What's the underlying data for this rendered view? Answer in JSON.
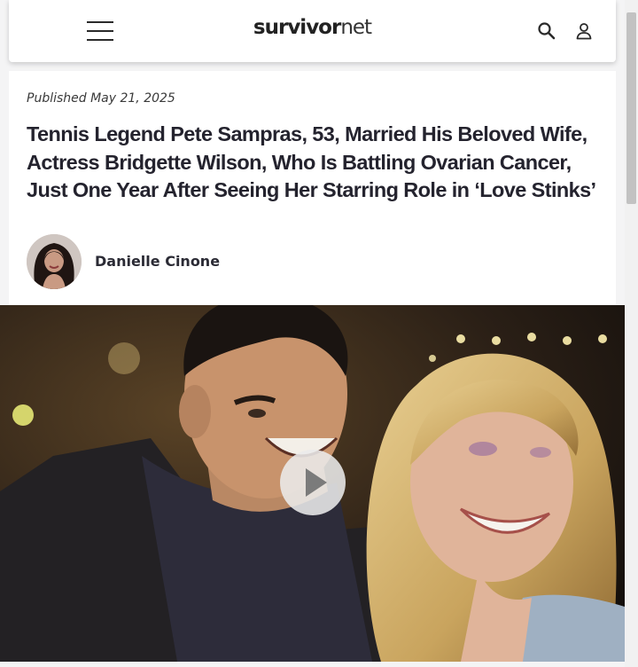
{
  "header": {
    "logo_part1": "survivor",
    "logo_part2": "net",
    "menu_icon": "hamburger-menu-icon",
    "search_icon": "search-icon",
    "account_icon": "user-icon"
  },
  "article": {
    "published": "Published May 21, 2025",
    "headline": "Tennis Legend Pete Sampras, 53, Married His Beloved Wife, Actress Bridgette Wilson, Who Is Battling Ovarian Cancer, Just One Year After Seeing Her Starring Role in ‘Love Stinks’",
    "author": "Danielle Cinone"
  },
  "media": {
    "play_icon": "play-icon"
  },
  "colors": {
    "header_bg": "#ffffff",
    "text_dark": "#24232e",
    "page_bg": "#f4f4f5"
  }
}
